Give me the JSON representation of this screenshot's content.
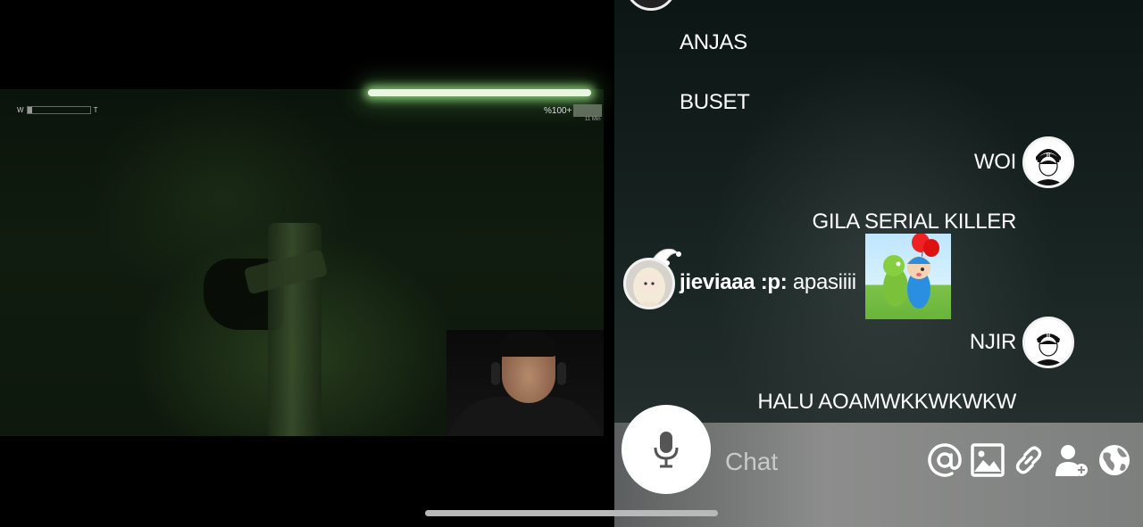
{
  "game": {
    "hud_left_start": "W",
    "hud_left_end": "T",
    "hud_left_level": 0.08,
    "hud_right_text": "%100+",
    "hud_right_sub": "11 Min"
  },
  "chat": {
    "messages": [
      {
        "text": "ANJAS",
        "align": "left"
      },
      {
        "text": "BUSET",
        "align": "left"
      },
      {
        "text": "WOI",
        "align": "right"
      },
      {
        "text": "GILA SERIAL KILLER",
        "align": "right"
      },
      {
        "username": "jieviaaa :p:",
        "text": "apasiiii",
        "align": "left"
      },
      {
        "text": "NJIR",
        "align": "right"
      },
      {
        "text": "HALU AOAMWKKWKWKW",
        "align": "right"
      }
    ],
    "input_placeholder": "Chat"
  },
  "icons": {
    "mic": "microphone-icon",
    "mention": "at-sign-icon",
    "image": "image-icon",
    "link": "link-icon",
    "invite": "add-user-icon",
    "globe": "globe-icon"
  },
  "colors": {
    "video_bg": "#000000",
    "chat_text": "#ffffff",
    "night_vision_green": "#2f4a24",
    "input_bar": "#8c8d8c"
  }
}
